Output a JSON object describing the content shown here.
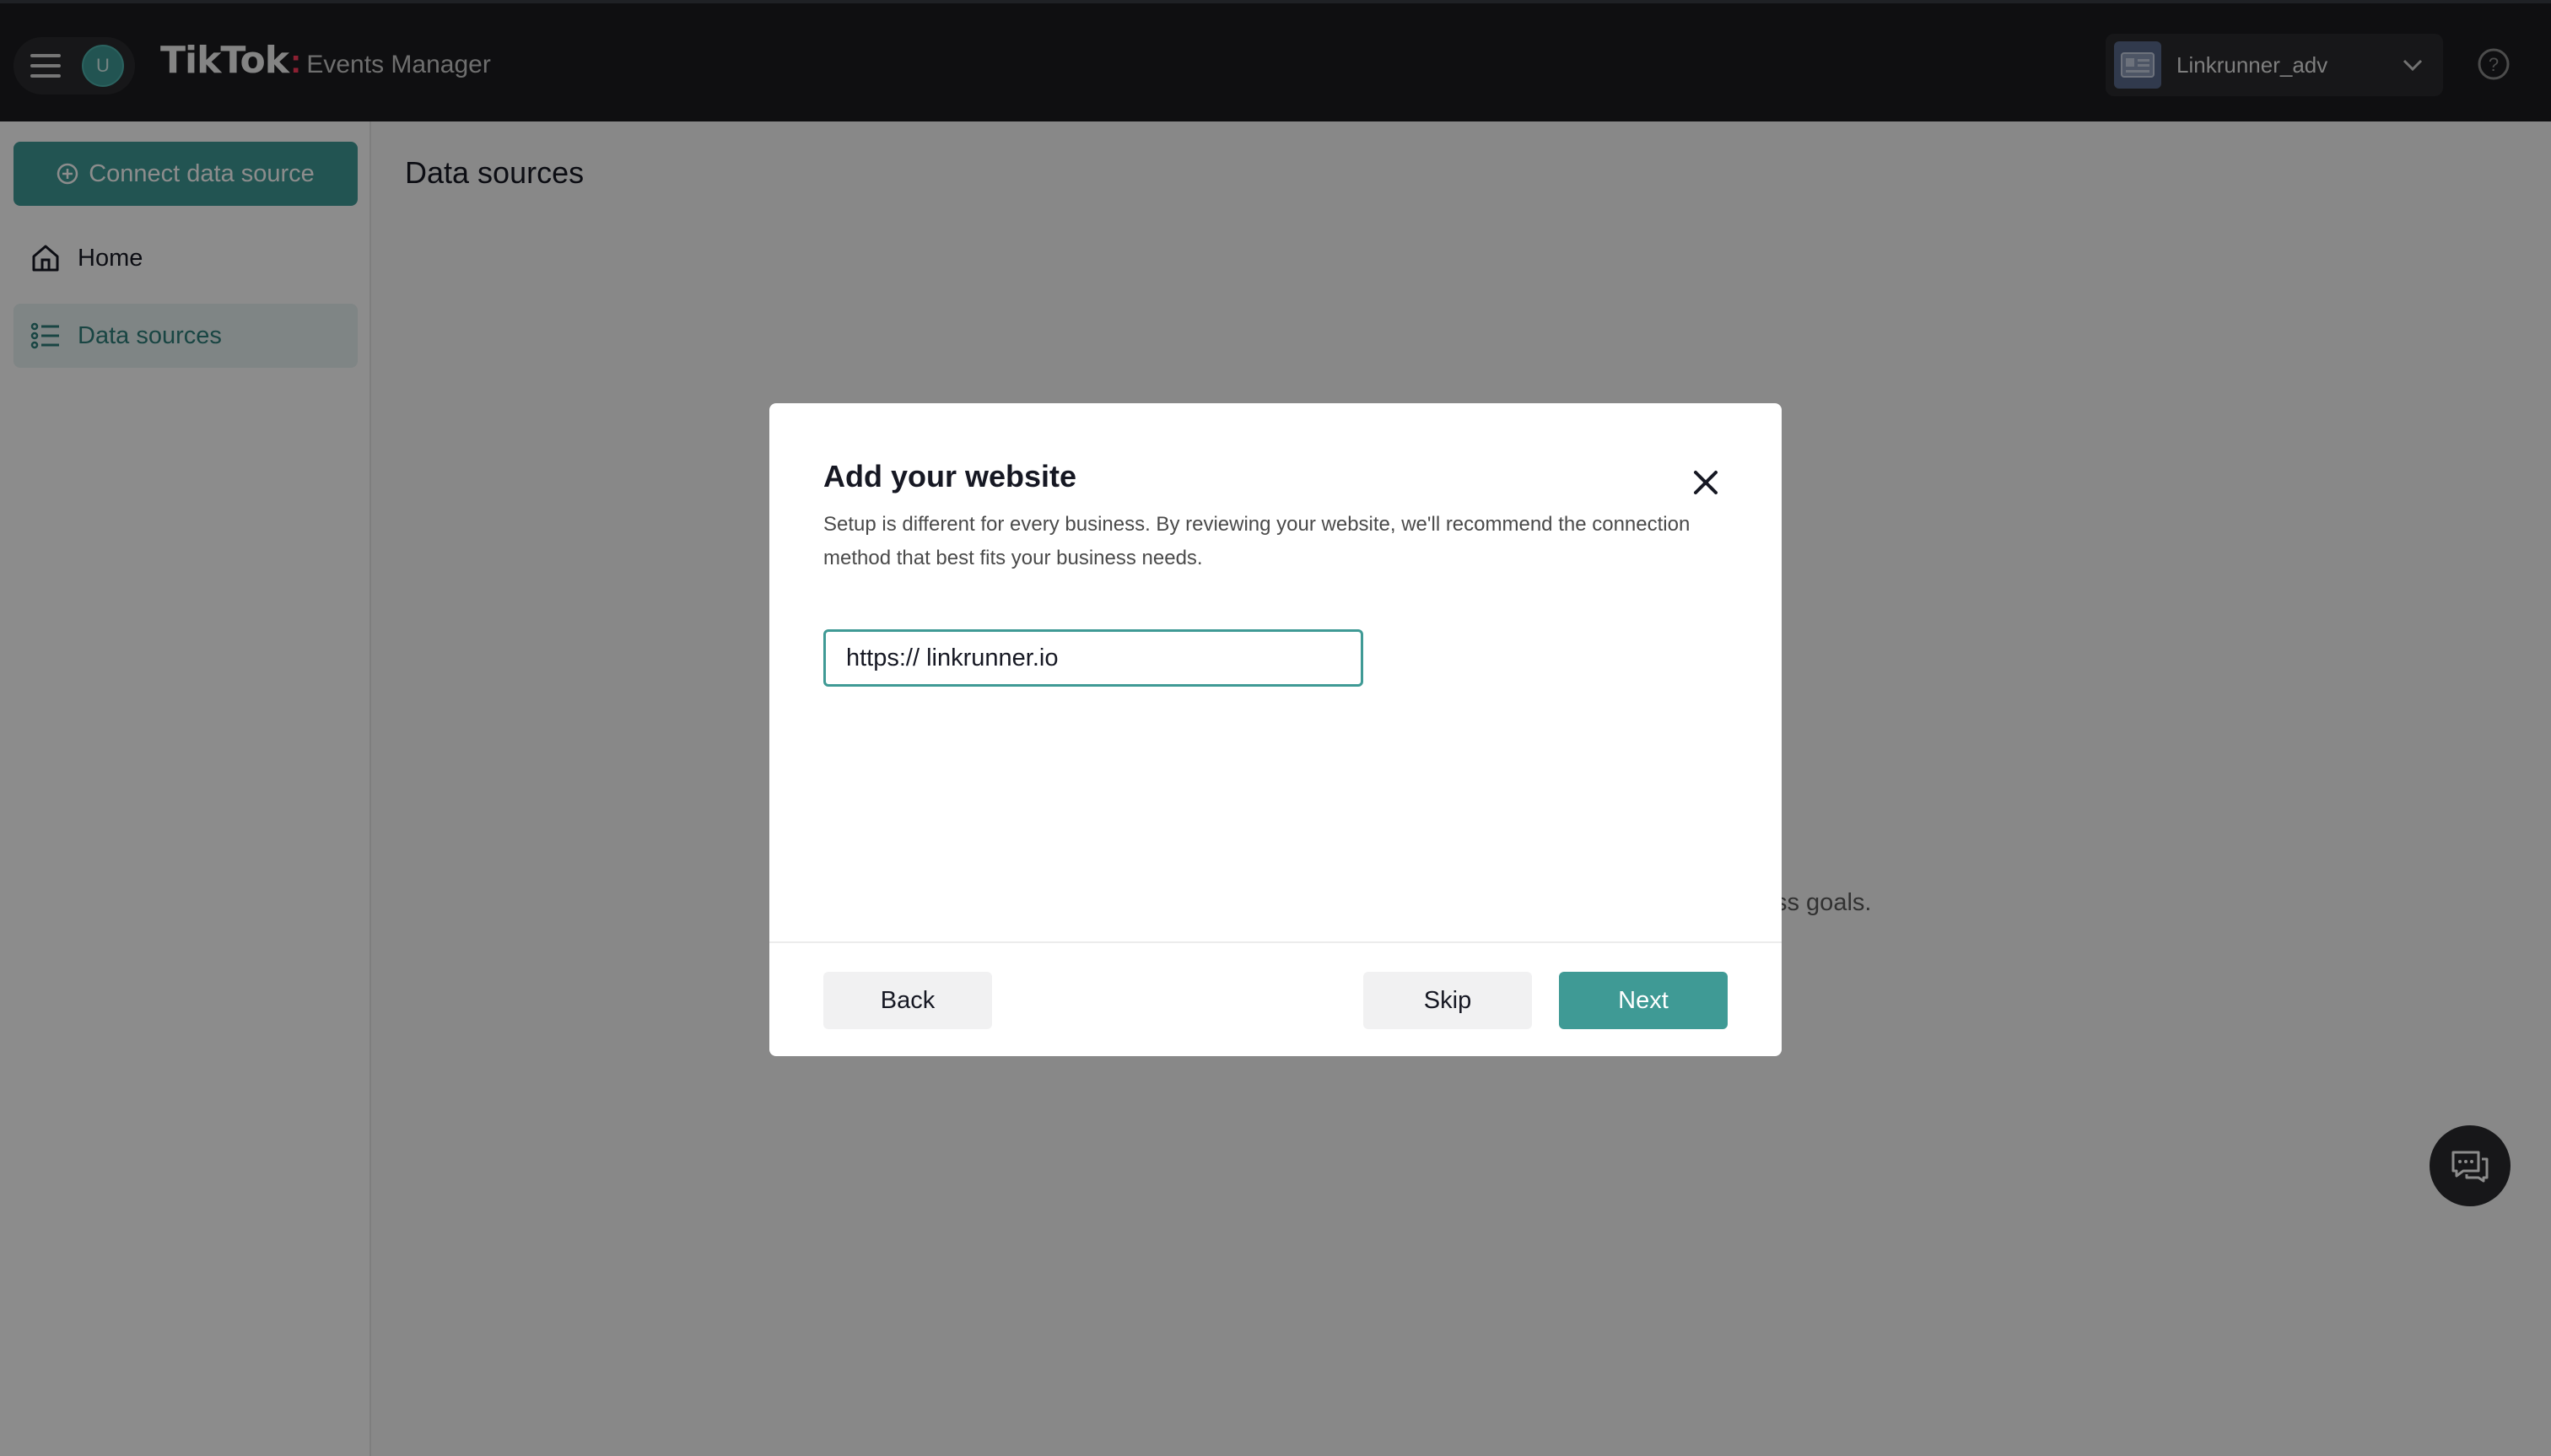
{
  "header": {
    "avatar_initial": "U",
    "brand_logo": "TikTok",
    "brand_dot": ":",
    "brand_sub": "Events Manager",
    "account_name": "Linkrunner_adv"
  },
  "sidebar": {
    "connect_label": "Connect data source",
    "items": [
      {
        "label": "Home",
        "icon": "home-icon"
      },
      {
        "label": "Data sources",
        "icon": "list-icon"
      }
    ]
  },
  "main": {
    "page_title": "Data sources",
    "partial_text": "ss goals."
  },
  "modal": {
    "title": "Add your website",
    "description": "Setup is different for every business. By reviewing your website, we'll recommend the connection method that best fits your business needs.",
    "url_value": "https:// linkrunner.io",
    "back_label": "Back",
    "skip_label": "Skip",
    "next_label": "Next"
  },
  "colors": {
    "accent": "#3f9a95",
    "topbar": "#1c1d1f",
    "overlay": "rgba(0,0,0,0.45)"
  }
}
